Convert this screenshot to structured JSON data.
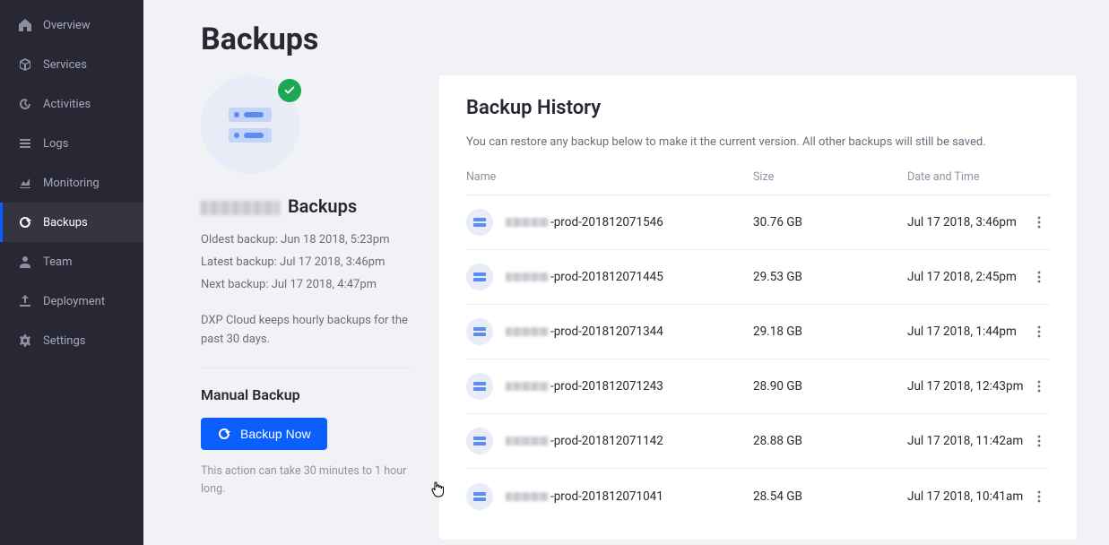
{
  "sidebar": {
    "items": [
      {
        "label": "Overview",
        "icon": "home",
        "active": false
      },
      {
        "label": "Services",
        "icon": "cube",
        "active": false
      },
      {
        "label": "Activities",
        "icon": "history",
        "active": false
      },
      {
        "label": "Logs",
        "icon": "list",
        "active": false
      },
      {
        "label": "Monitoring",
        "icon": "chart",
        "active": false
      },
      {
        "label": "Backups",
        "icon": "refresh",
        "active": true
      },
      {
        "label": "Team",
        "icon": "user",
        "active": false
      },
      {
        "label": "Deployment",
        "icon": "upload",
        "active": false
      },
      {
        "label": "Settings",
        "icon": "gear",
        "active": false
      }
    ]
  },
  "page": {
    "title": "Backups"
  },
  "info": {
    "heading_suffix": "Backups",
    "oldest_label": "Oldest backup:",
    "oldest_value": "Jun 18 2018, 5:23pm",
    "latest_label": "Latest backup:",
    "latest_value": "Jul 17 2018, 3:46pm",
    "next_label": "Next backup:",
    "next_value": "Jul 17 2018, 4:47pm",
    "note": "DXP Cloud keeps hourly backups for the past 30 days.",
    "manual_heading": "Manual Backup",
    "backup_button": "Backup Now",
    "hint": "This action can take 30 minutes to 1 hour long."
  },
  "history": {
    "title": "Backup History",
    "description": "You can restore any backup below to make it the current version. All other backups will still be saved.",
    "columns": {
      "name": "Name",
      "size": "Size",
      "date": "Date and Time"
    },
    "rows": [
      {
        "name_suffix": "-prod-201812071546",
        "size": "30.76 GB",
        "date": "Jul 17 2018, 3:46pm"
      },
      {
        "name_suffix": "-prod-201812071445",
        "size": "29.53 GB",
        "date": "Jul 17 2018, 2:45pm"
      },
      {
        "name_suffix": "-prod-201812071344",
        "size": "29.18 GB",
        "date": "Jul 17 2018, 1:44pm"
      },
      {
        "name_suffix": "-prod-201812071243",
        "size": "28.90 GB",
        "date": "Jul 17 2018, 12:43pm"
      },
      {
        "name_suffix": "-prod-201812071142",
        "size": "28.88 GB",
        "date": "Jul 17 2018, 11:42am"
      },
      {
        "name_suffix": "-prod-201812071041",
        "size": "28.54 GB",
        "date": "Jul 17 2018, 10:41am"
      }
    ]
  }
}
